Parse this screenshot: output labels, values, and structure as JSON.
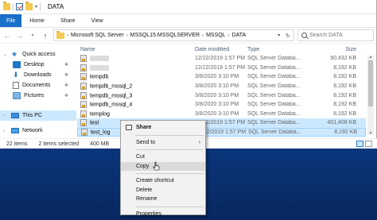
{
  "window": {
    "title": "DATA"
  },
  "ribbon": {
    "tabs": [
      "File",
      "Home",
      "Share",
      "View"
    ]
  },
  "address": {
    "crumbs": [
      "Microsoft SQL Server",
      "MSSQL15.MSSQLSERVER",
      "MSSQL",
      "DATA"
    ],
    "search_placeholder": "Search DATA"
  },
  "nav": {
    "quick_access": "Quick access",
    "items": [
      "Desktop",
      "Downloads",
      "Documents",
      "Pictures"
    ],
    "this_pc": "This PC",
    "network": "Network"
  },
  "columns": {
    "name": "Name",
    "date": "Date modified",
    "type": "Type",
    "size": "Size"
  },
  "files": [
    {
      "name": "",
      "date": "12/22/2019 1:57 PM",
      "type": "SQL Server Databa...",
      "size": "90,432 KB"
    },
    {
      "name": "",
      "date": "12/22/2019 1:57 PM",
      "type": "SQL Server Databa...",
      "size": "8,192 KB"
    },
    {
      "name": "tempdb",
      "date": "3/8/2020 3:10 PM",
      "type": "SQL Server Databa...",
      "size": "8,192 KB"
    },
    {
      "name": "tempdb_mssql_2",
      "date": "3/8/2020 3:10 PM",
      "type": "SQL Server Databa...",
      "size": "8,192 KB"
    },
    {
      "name": "tempdb_mssql_3",
      "date": "3/8/2020 3:10 PM",
      "type": "SQL Server Databa...",
      "size": "8,192 KB"
    },
    {
      "name": "tempdb_mssql_4",
      "date": "3/8/2020 3:10 PM",
      "type": "SQL Server Databa...",
      "size": "8,192 KB"
    },
    {
      "name": "templog",
      "date": "3/8/2020 3:10 PM",
      "type": "SQL Server Databa...",
      "size": "8,192 KB"
    },
    {
      "name": "test",
      "date": "12/22/2019 1:57 PM",
      "type": "SQL Server Databa...",
      "size": "401,408 KB"
    },
    {
      "name": "test_log",
      "date": "12/22/2019 1:57 PM",
      "type": "SQL Server Databa...",
      "size": "8,192 KB"
    }
  ],
  "status": {
    "items": "22 items",
    "selected": "2 items selected",
    "size": "400 MB"
  },
  "context_menu": {
    "share": "Share",
    "send_to": "Send to",
    "cut": "Cut",
    "copy": "Copy",
    "create_shortcut": "Create shortcut",
    "delete": "Delete",
    "rename": "Rename",
    "properties": "Properties"
  }
}
